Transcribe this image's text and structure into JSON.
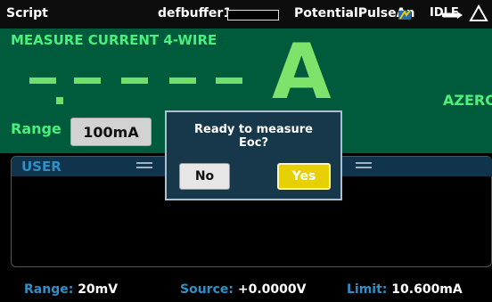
{
  "statusbar": {
    "script": "Script",
    "buffer": "defbuffer1",
    "test_name": "PotentialPulseAn",
    "state": "IDLE"
  },
  "measure": {
    "function": "MEASURE CURRENT 4-WIRE",
    "reading": "------.",
    "unit": "A",
    "autozero": "AZERO",
    "range_label": "Range",
    "range_value": "100mA"
  },
  "swipe": {
    "tab": "USER",
    "range_key": "Range:",
    "range_value": "20mV",
    "source_key": "Source:",
    "source_value": "+0.0000V",
    "limit_key": "Limit:",
    "limit_value": "10.600mA"
  },
  "dialog": {
    "message_line1": "Ready to measure",
    "message_line2": "Eoc?",
    "no_label": "No",
    "yes_label": "Yes"
  },
  "colors": {
    "measure_bg": "#005a3c",
    "measure_text": "#48f07c",
    "swipe_header": "#0f344c",
    "key_blue": "#2f8fc6",
    "yes_yellow": "#e7d000",
    "dialog_bg": "#16384a"
  },
  "icons": [
    "buffer-bar-icon",
    "run-status-icon",
    "idle-arrow-icon",
    "warning-icon",
    "swipe-grip-icon"
  ]
}
